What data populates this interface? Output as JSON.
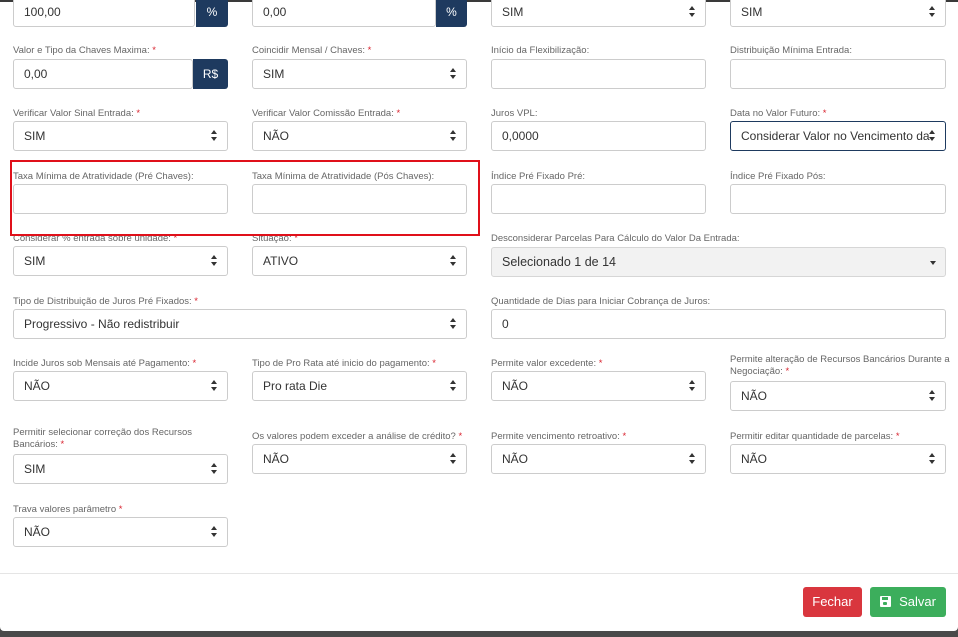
{
  "row0": {
    "c1": {
      "value": "100,00",
      "addon": "%"
    },
    "c2": {
      "value": "0,00",
      "addon": "%"
    },
    "c3": {
      "value": "SIM"
    },
    "c4": {
      "value": "SIM"
    }
  },
  "row1": {
    "c1": {
      "label": "Valor e Tipo da Chaves Maxima:",
      "value": "0,00",
      "addon": "R$"
    },
    "c2": {
      "label": "Coincidir Mensal / Chaves:",
      "value": "SIM"
    },
    "c3": {
      "label": "Início da Flexibilização:",
      "value": ""
    },
    "c4": {
      "label": "Distribuição Mínima Entrada:",
      "value": ""
    }
  },
  "row2": {
    "c1": {
      "label": "Verificar Valor Sinal Entrada:",
      "value": "SIM"
    },
    "c2": {
      "label": "Verificar Valor Comissão Entrada:",
      "value": "NÃO"
    },
    "c3": {
      "label": "Juros VPL:",
      "value": "0,0000"
    },
    "c4": {
      "label": "Data no Valor Futuro:",
      "value": "Considerar Valor no Vencimento da"
    }
  },
  "row3": {
    "c1": {
      "label": "Taxa Mínima de Atratividade (Pré Chaves):",
      "value": ""
    },
    "c2": {
      "label": "Taxa Mínima de Atratividade (Pós Chaves):",
      "value": ""
    },
    "c3": {
      "label": "Índice Pré Fixado Pré:",
      "value": ""
    },
    "c4": {
      "label": "Índice Pré Fixado Pós:",
      "value": ""
    }
  },
  "row4": {
    "c1": {
      "label": "Considerar % entrada sobre unidade:",
      "value": "SIM"
    },
    "c2": {
      "label": "Situação:",
      "value": "ATIVO"
    },
    "c3": {
      "label": "Desconsiderar Parcelas Para Cálculo do Valor Da Entrada:",
      "value": "Selecionado 1 de 14"
    }
  },
  "row5": {
    "c1": {
      "label": "Tipo de Distribuição de Juros Pré Fixados:",
      "value": "Progressivo - Não redistribuir"
    },
    "c3": {
      "label": "Quantidade de Dias para Iniciar Cobrança de Juros:",
      "value": "0"
    }
  },
  "row6": {
    "c1": {
      "label": "Incide Juros sob Mensais até Pagamento:",
      "value": "NÃO"
    },
    "c2": {
      "label": "Tipo de Pro Rata até inicio do pagamento:",
      "value": "Pro rata Die"
    },
    "c3": {
      "label": "Permite valor excedente:",
      "value": "NÃO"
    },
    "c4": {
      "label": "Permite alteração de Recursos Bancários Durante a Negociação:",
      "value": "NÃO"
    }
  },
  "row7": {
    "c1": {
      "label": "Permitir selecionar correção dos Recursos Bancários:",
      "value": "SIM"
    },
    "c2": {
      "label": "Os valores podem exceder a análise de crédito?",
      "value": "NÃO"
    },
    "c3": {
      "label": "Permite vencimento retroativo:",
      "value": "NÃO"
    },
    "c4": {
      "label": "Permitir editar quantidade de parcelas:",
      "value": "NÃO"
    }
  },
  "row8": {
    "c1": {
      "label": "Trava valores parâmetro",
      "value": "NÃO"
    }
  },
  "required_mark": "*",
  "footer": {
    "close_label": "Fechar",
    "save_label": "Salvar"
  },
  "colors": {
    "addon": "#1e3a5f",
    "close": "#d9363e",
    "save": "#3cae5c",
    "highlight": "#e0101a"
  }
}
